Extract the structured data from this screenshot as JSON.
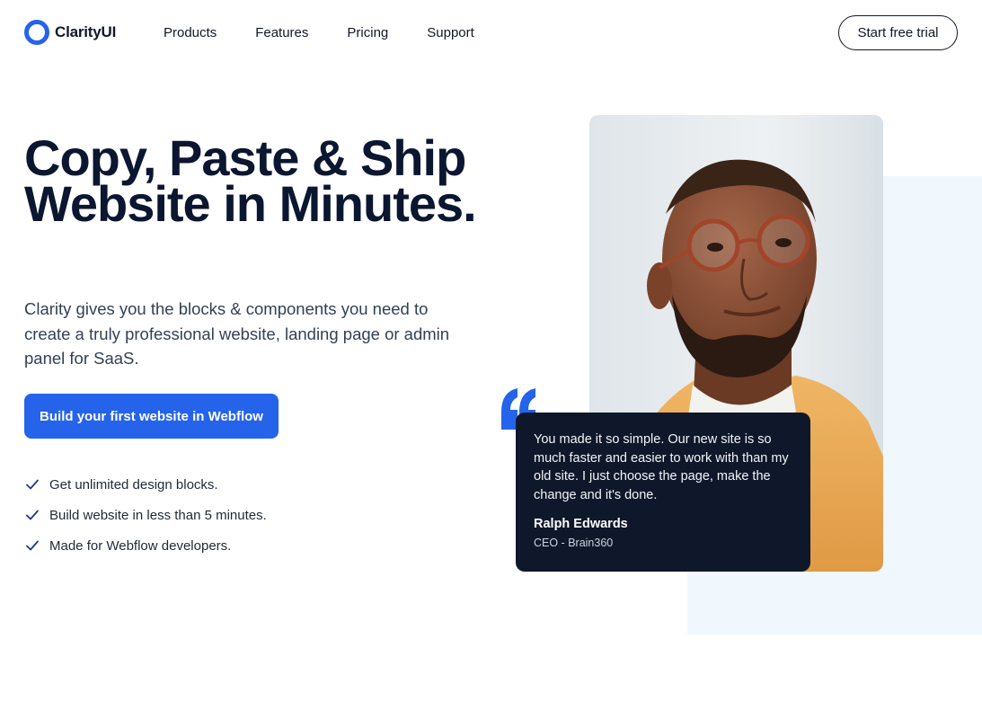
{
  "header": {
    "brand": "ClarityUI",
    "nav": [
      "Products",
      "Features",
      "Pricing",
      "Support"
    ],
    "cta_label": "Start free trial"
  },
  "hero": {
    "headline": "Copy, Paste & Ship Website in Minutes.",
    "subtext": "Clarity gives you the blocks & components you need to create a truly professional website, landing page or admin panel for SaaS.",
    "cta_label": "Build your first website in Webflow",
    "features": [
      "Get unlimited design blocks.",
      "Build website in less than 5 minutes.",
      "Made for Webflow developers."
    ]
  },
  "testimonial": {
    "quote": "You made it so simple. Our new site is so much faster and easier to work with than my old site. I just choose the page, make the change and it's done.",
    "name": "Ralph Edwards",
    "role": "CEO - Brain360"
  },
  "colors": {
    "accent": "#2563eb",
    "dark": "#0f172a",
    "panel": "#f1f8fd"
  }
}
